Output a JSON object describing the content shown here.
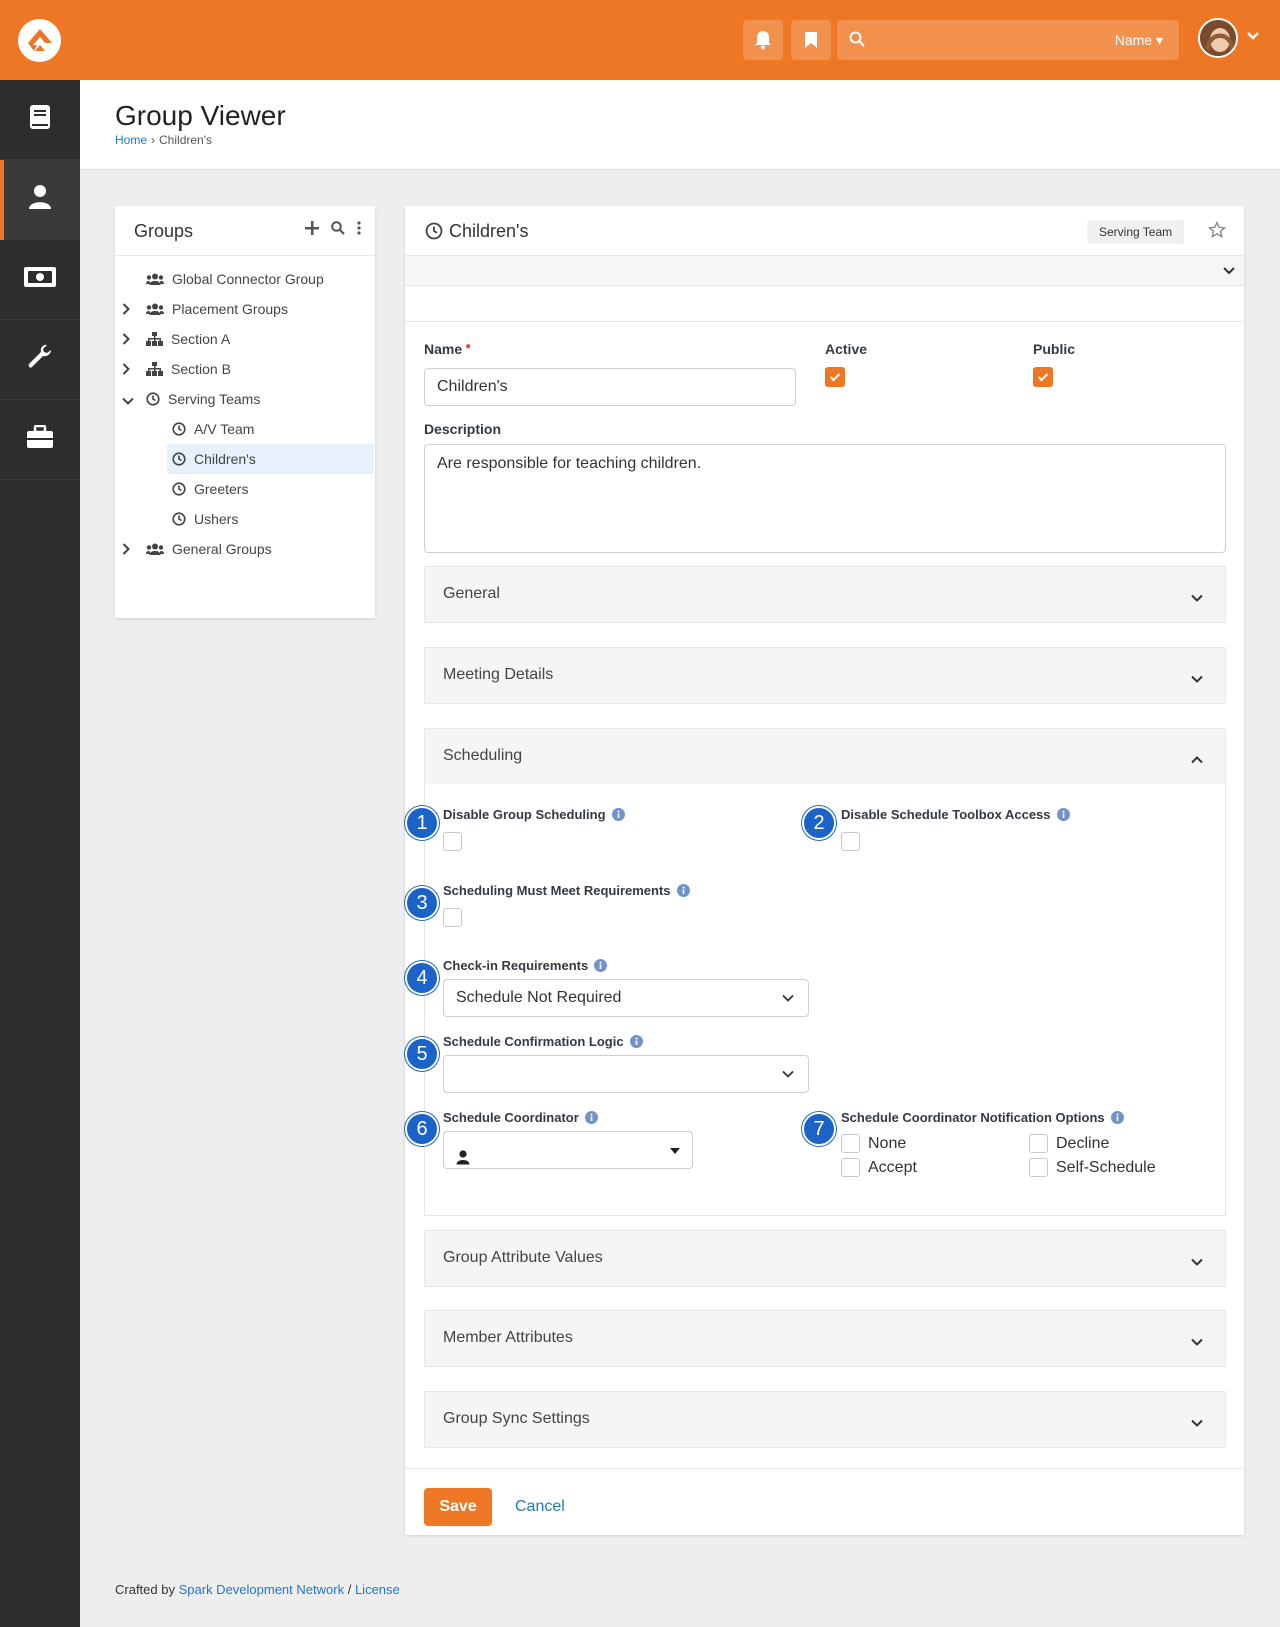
{
  "topbar": {
    "search_placeholder": "",
    "search_scope": "Name",
    "accent": "#ee7725"
  },
  "sidebar": {
    "items": [
      {
        "icon": "book-icon"
      },
      {
        "icon": "person-icon",
        "active": true
      },
      {
        "icon": "money-icon"
      },
      {
        "icon": "wrench-icon"
      },
      {
        "icon": "briefcase-icon"
      }
    ]
  },
  "page": {
    "title": "Group Viewer",
    "breadcrumb": {
      "home": "Home",
      "current": "Children's"
    }
  },
  "groups": {
    "title": "Groups",
    "tree": [
      {
        "label": "Global Connector Group",
        "icon": "users-icon"
      },
      {
        "label": "Placement Groups",
        "icon": "users-icon"
      },
      {
        "label": "Section A",
        "icon": "sitemap-icon"
      },
      {
        "label": "Section B",
        "icon": "sitemap-icon"
      },
      {
        "label": "Serving Teams",
        "icon": "clock-icon"
      },
      {
        "label": "A/V Team",
        "icon": "clock-icon"
      },
      {
        "label": "Children's",
        "icon": "clock-icon",
        "selected": true
      },
      {
        "label": "Greeters",
        "icon": "clock-icon"
      },
      {
        "label": "Ushers",
        "icon": "clock-icon"
      },
      {
        "label": "General Groups",
        "icon": "users-icon"
      }
    ]
  },
  "main": {
    "title": "Children's",
    "badge": "Serving Team",
    "form": {
      "name_label": "Name",
      "name_value": "Children's",
      "active_label": "Active",
      "public_label": "Public",
      "description_label": "Description",
      "description_value": "Are responsible for teaching children."
    },
    "sections": {
      "general": "General",
      "meeting": "Meeting Details",
      "scheduling": "Scheduling",
      "group_attr": "Group Attribute Values",
      "member_attr": "Member Attributes",
      "sync": "Group Sync Settings"
    },
    "scheduling": {
      "disable_group_scheduling": "Disable Group Scheduling",
      "disable_toolbox": "Disable Schedule Toolbox Access",
      "must_meet": "Scheduling Must Meet Requirements",
      "checkin_req": "Check-in Requirements",
      "checkin_value": "Schedule Not Required",
      "confirm_logic": "Schedule Confirmation Logic",
      "confirm_value": "",
      "coordinator": "Schedule Coordinator",
      "notify_options": "Schedule Coordinator Notification Options",
      "opt_none": "None",
      "opt_decline": "Decline",
      "opt_accept": "Accept",
      "opt_self": "Self-Schedule"
    },
    "callouts": [
      "1",
      "2",
      "3",
      "4",
      "5",
      "6",
      "7"
    ],
    "save_label": "Save",
    "cancel_label": "Cancel"
  },
  "footer": {
    "prefix": "Crafted by",
    "link": "Spark Development Network",
    "sep": "/",
    "license": "License"
  }
}
